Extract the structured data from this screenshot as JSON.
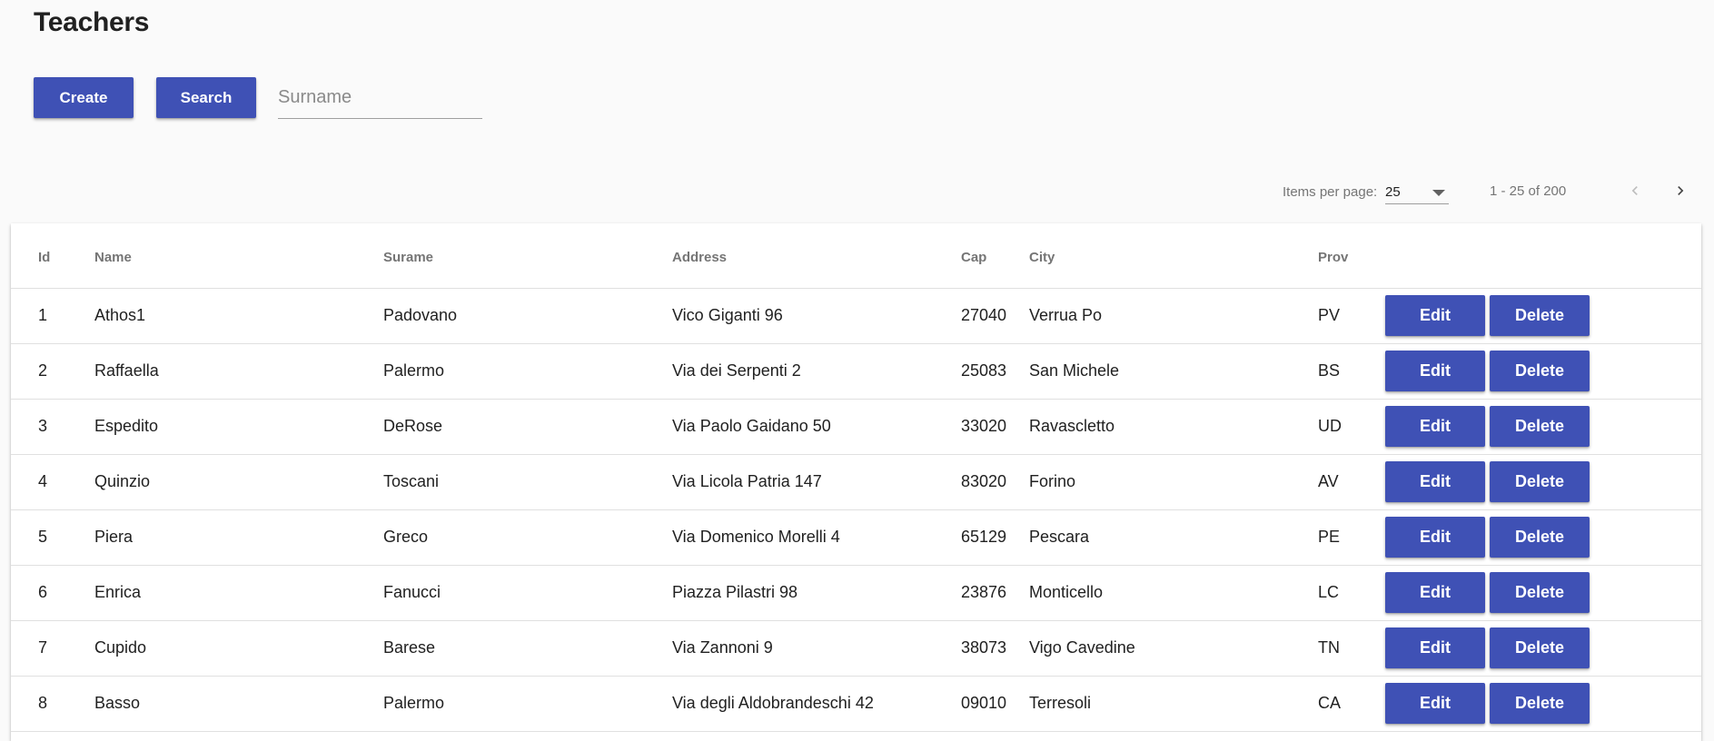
{
  "page": {
    "title": "Teachers"
  },
  "toolbar": {
    "create_label": "Create",
    "search_label": "Search",
    "surname_placeholder": "Surname",
    "surname_value": ""
  },
  "paginator": {
    "items_per_page_label": "Items per page:",
    "page_size": "25",
    "range_label": "1 - 25 of 200",
    "prev_icon": "chevron-left-icon",
    "next_icon": "chevron-right-icon"
  },
  "table": {
    "columns": [
      "Id",
      "Name",
      "Surame",
      "Address",
      "Cap",
      "City",
      "Prov"
    ],
    "edit_label": "Edit",
    "delete_label": "Delete",
    "rows": [
      {
        "id": "1",
        "name": "Athos1",
        "surname": "Padovano",
        "address": "Vico Giganti 96",
        "cap": "27040",
        "city": "Verrua Po",
        "prov": "PV"
      },
      {
        "id": "2",
        "name": "Raffaella",
        "surname": "Palermo",
        "address": "Via dei Serpenti 2",
        "cap": "25083",
        "city": "San Michele",
        "prov": "BS"
      },
      {
        "id": "3",
        "name": "Espedito",
        "surname": "DeRose",
        "address": "Via Paolo Gaidano 50",
        "cap": "33020",
        "city": "Ravascletto",
        "prov": "UD"
      },
      {
        "id": "4",
        "name": "Quinzio",
        "surname": "Toscani",
        "address": "Via Licola Patria 147",
        "cap": "83020",
        "city": "Forino",
        "prov": "AV"
      },
      {
        "id": "5",
        "name": "Piera",
        "surname": "Greco",
        "address": "Via Domenico Morelli 4",
        "cap": "65129",
        "city": "Pescara",
        "prov": "PE"
      },
      {
        "id": "6",
        "name": "Enrica",
        "surname": "Fanucci",
        "address": "Piazza Pilastri 98",
        "cap": "23876",
        "city": "Monticello",
        "prov": "LC"
      },
      {
        "id": "7",
        "name": "Cupido",
        "surname": "Barese",
        "address": "Via Zannoni 9",
        "cap": "38073",
        "city": "Vigo Cavedine",
        "prov": "TN"
      },
      {
        "id": "8",
        "name": "Basso",
        "surname": "Palermo",
        "address": "Via degli Aldobrandeschi 42",
        "cap": "09010",
        "city": "Terresoli",
        "prov": "CA"
      }
    ]
  },
  "colors": {
    "primary": "#3f51b5",
    "background": "#fafafa",
    "divider": "#e0e0e0",
    "header_text": "#757575"
  }
}
